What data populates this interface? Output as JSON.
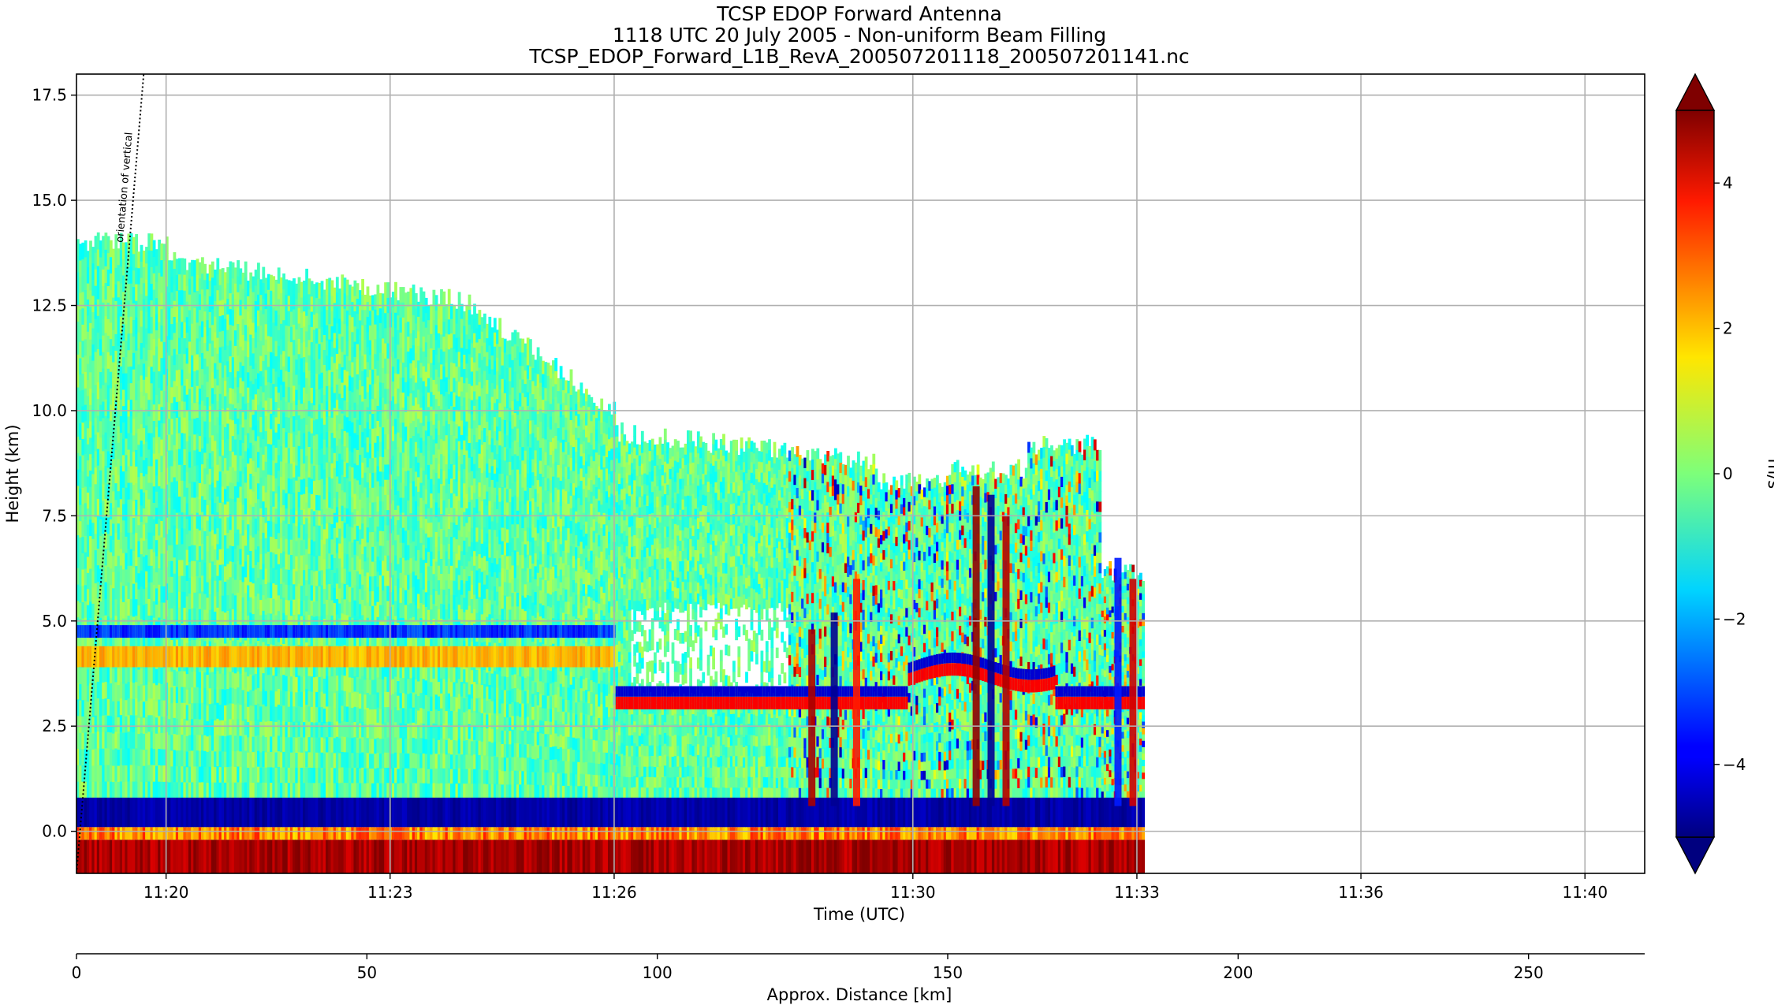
{
  "chart_data": {
    "type": "heatmap",
    "title_lines": [
      "TCSP EDOP Forward Antenna",
      "1118 UTC 20 July 2005 - Non-uniform Beam Filling",
      "TCSP_EDOP_Forward_L1B_RevA_200507201118_200507201141.nc"
    ],
    "xlabel": "Time (UTC)",
    "ylabel": "Height (km)",
    "x2label": "Approx. Distance [km]",
    "colorbar_label": "m/s",
    "time_range_min": [
      678.8,
      699.8
    ],
    "ylim": [
      -1.0,
      18.0
    ],
    "x2lim": [
      0,
      270
    ],
    "clim": [
      -5,
      5
    ],
    "colorbar_extend": "both",
    "colormap": "jet",
    "grid": true,
    "xticks": [
      {
        "t": 680,
        "label": "11:20"
      },
      {
        "t": 683,
        "label": "11:23"
      },
      {
        "t": 686,
        "label": "11:26"
      },
      {
        "t": 690,
        "label": "11:30"
      },
      {
        "t": 693,
        "label": "11:33"
      },
      {
        "t": 696,
        "label": "11:36"
      },
      {
        "t": 699,
        "label": "11:40"
      }
    ],
    "yticks": [
      {
        "v": 0.0,
        "label": "0.0"
      },
      {
        "v": 2.5,
        "label": "2.5"
      },
      {
        "v": 5.0,
        "label": "5.0"
      },
      {
        "v": 7.5,
        "label": "7.5"
      },
      {
        "v": 10.0,
        "label": "10.0"
      },
      {
        "v": 12.5,
        "label": "12.5"
      },
      {
        "v": 15.0,
        "label": "15.0"
      },
      {
        "v": 17.5,
        "label": "17.5"
      }
    ],
    "x2ticks": [
      {
        "v": 0,
        "label": "0"
      },
      {
        "v": 50,
        "label": "50"
      },
      {
        "v": 100,
        "label": "100"
      },
      {
        "v": 150,
        "label": "150"
      },
      {
        "v": 200,
        "label": "200"
      },
      {
        "v": 250,
        "label": "250"
      }
    ],
    "cticks": [
      {
        "v": 4,
        "label": "4"
      },
      {
        "v": 2,
        "label": "2"
      },
      {
        "v": 0,
        "label": "0"
      },
      {
        "v": -2,
        "label": "−2"
      },
      {
        "v": -4,
        "label": "−4"
      }
    ],
    "annotation": {
      "text": "orientation of vertical",
      "line_from": {
        "t": 678.8,
        "h": -1.0
      },
      "line_to": {
        "t": 679.7,
        "h": 18.0
      }
    },
    "data_extent_min": [
      678.8,
      693.1
    ],
    "fields": [
      {
        "name": "surface return",
        "h": [
          -1.0,
          -0.2
        ],
        "velocity": 5
      },
      {
        "name": "near-surface layer",
        "h": [
          0.1,
          0.8
        ],
        "velocity": -5
      },
      {
        "name": "melting-level band (upper)",
        "h": [
          4.6,
          4.9
        ],
        "velocity": -4
      },
      {
        "name": "melting-level band (lower)",
        "h": [
          3.9,
          4.4
        ],
        "velocity": 2
      },
      {
        "name": "stratiform anvil",
        "h": [
          0.8,
          14.3
        ],
        "velocity": 0
      },
      {
        "name": "convective cells",
        "t": [
          688.5,
          693.0
        ],
        "h": [
          0.5,
          10.5
        ],
        "velocity_range": [
          -5,
          5
        ]
      }
    ]
  }
}
